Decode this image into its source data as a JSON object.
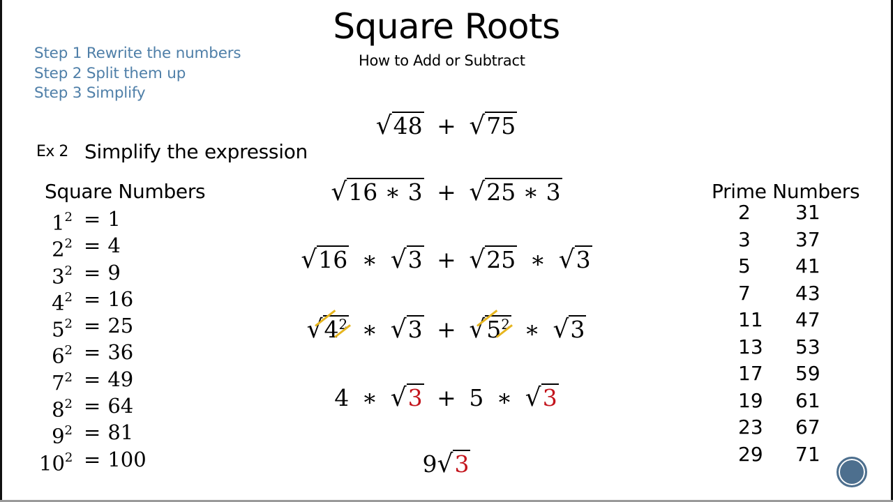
{
  "slide": {
    "title": "Square Roots",
    "subtitle": "How to Add or Subtract",
    "steps": [
      "Step 1 Rewrite the numbers",
      "Step 2 Split them up",
      "Step 3 Simplify"
    ],
    "example": {
      "label": "Ex 2",
      "text": "Simplify the expression"
    },
    "colors": {
      "steps_text": "#4f7fa8",
      "highlight_red": "#c3141c",
      "strike_yellow": "#e6b51e",
      "nav_button": "#4d6f8e"
    }
  },
  "square_numbers": {
    "heading": "Square Numbers",
    "rows": [
      {
        "base": "1",
        "exp": "2",
        "eq": "=",
        "value": "1"
      },
      {
        "base": "2",
        "exp": "2",
        "eq": "=",
        "value": "4"
      },
      {
        "base": "3",
        "exp": "2",
        "eq": "=",
        "value": "9"
      },
      {
        "base": "4",
        "exp": "2",
        "eq": "=",
        "value": "16"
      },
      {
        "base": "5",
        "exp": "2",
        "eq": "=",
        "value": "25"
      },
      {
        "base": "6",
        "exp": "2",
        "eq": "=",
        "value": "36"
      },
      {
        "base": "7",
        "exp": "2",
        "eq": "=",
        "value": "49"
      },
      {
        "base": "8",
        "exp": "2",
        "eq": "=",
        "value": "64"
      },
      {
        "base": "9",
        "exp": "2",
        "eq": "=",
        "value": "81"
      },
      {
        "base": "10",
        "exp": "2",
        "eq": "=",
        "value": "100"
      }
    ]
  },
  "work": {
    "line1": {
      "a": "48",
      "op": "+",
      "b": "75"
    },
    "line2": {
      "a": "16 ∗ 3",
      "op": "+",
      "b": "25 ∗ 3"
    },
    "line3": {
      "a": "16",
      "times1": "∗",
      "a3": "3",
      "op": "+",
      "b": "25",
      "times2": "∗",
      "b3": "3"
    },
    "line4": {
      "a_base": "4",
      "a_exp": "2",
      "times1": "∗",
      "a3": "3",
      "op": "+",
      "b_base": "5",
      "b_exp": "2",
      "times2": "∗",
      "b3": "3"
    },
    "line5": {
      "a": "4",
      "times1": "∗",
      "a3": "3",
      "op": "+",
      "b": "5",
      "times2": "∗",
      "b3": "3"
    },
    "line6": {
      "coef": "9",
      "rad": "3"
    }
  },
  "prime_numbers": {
    "heading": "Prime Numbers",
    "col1": [
      "2",
      "3",
      "5",
      "7",
      "11",
      "13",
      "17",
      "19",
      "23",
      "29"
    ],
    "col2": [
      "31",
      "37",
      "41",
      "43",
      "47",
      "53",
      "59",
      "61",
      "67",
      "71"
    ]
  },
  "nav": {
    "icon": "circle-nav-icon"
  }
}
